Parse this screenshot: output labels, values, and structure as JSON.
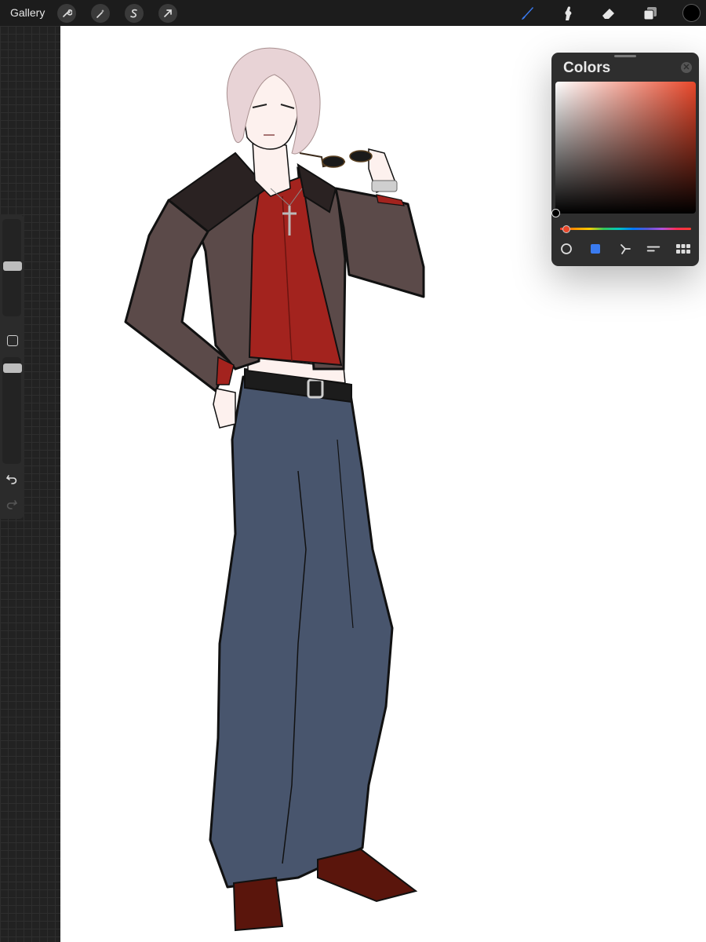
{
  "topbar": {
    "gallery_label": "Gallery",
    "left_tools": [
      "wrench-icon",
      "magic-wand-icon",
      "selection-s-icon",
      "transform-arrow-icon"
    ],
    "right_tools": [
      "brush-icon",
      "smudge-icon",
      "eraser-icon",
      "layers-icon"
    ],
    "active_tool": "brush-icon",
    "active_color": "#000000",
    "accent": "#3a7bf0"
  },
  "sidebar": {
    "brush_size_level": 0.52,
    "opacity_level": 0.93
  },
  "colors_panel": {
    "title": "Colors",
    "hue_color": "#e8472a",
    "modes": [
      "disc-icon",
      "classic-icon",
      "harmony-icon",
      "value-icon",
      "palettes-icon"
    ],
    "active_mode": "classic-icon"
  },
  "canvas": {
    "background": "#ffffff",
    "palette": {
      "hair": "#e8d3d6",
      "skin": "#fdf1ee",
      "jacket": "#5b4a49",
      "jacket_shadow": "#2a2222",
      "shirt": "#a3231e",
      "jeans": "#48556d",
      "belt": "#1c1c1c",
      "shoes": "#5a150c",
      "line": "#111111"
    }
  }
}
